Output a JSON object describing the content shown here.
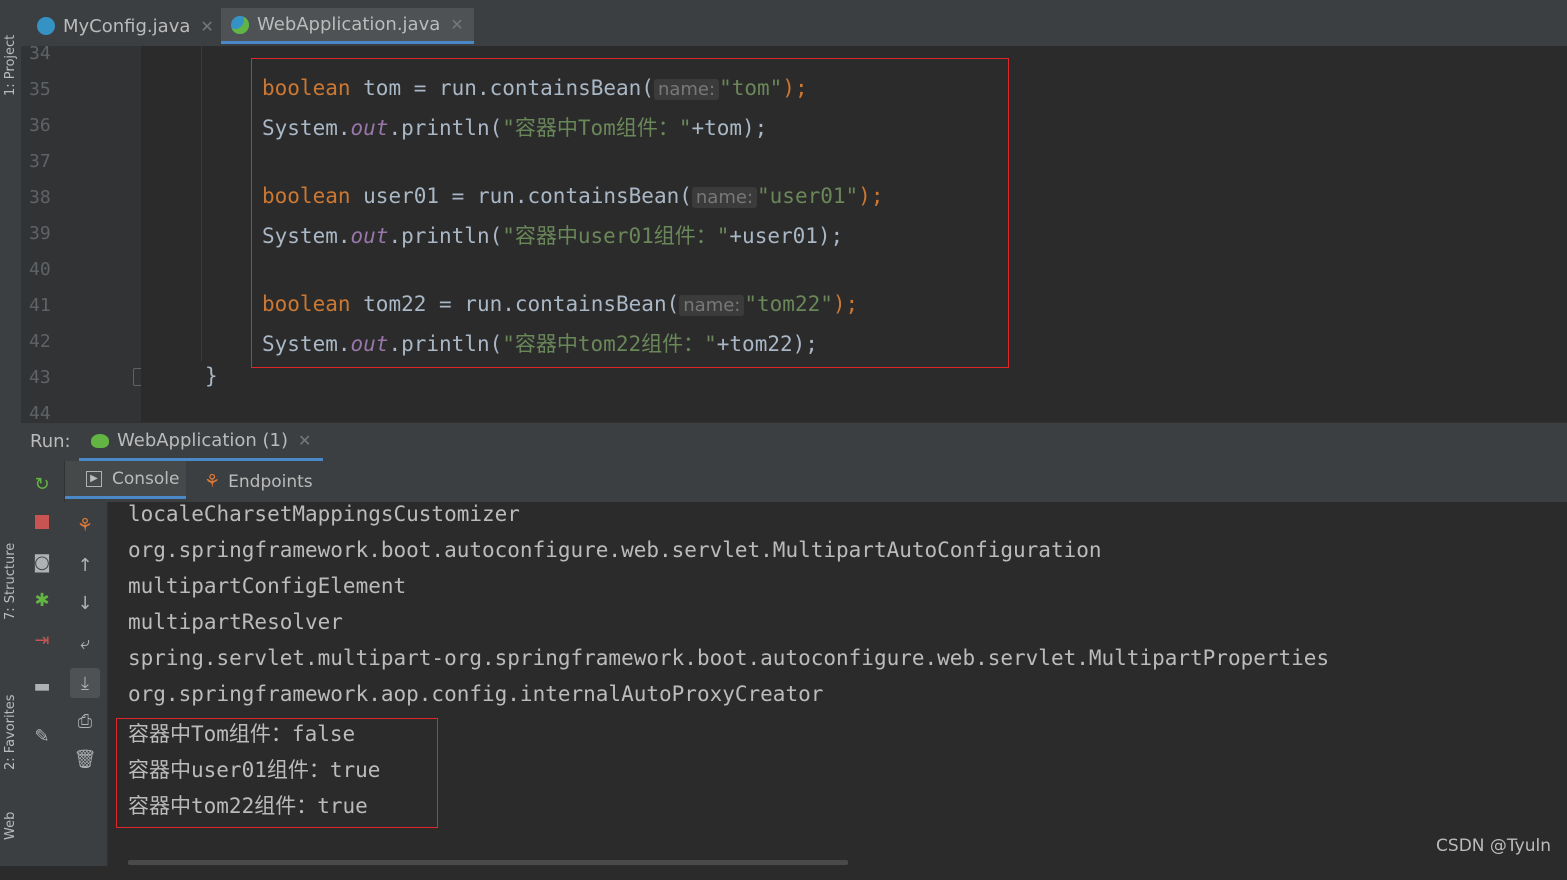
{
  "sidebar": {
    "project": "1: Project",
    "structure": "7: Structure",
    "favorites": "2: Favorites",
    "web": "Web"
  },
  "tabs": [
    {
      "label": "MyConfig.java",
      "icon": "java-class-icon",
      "active": false
    },
    {
      "label": "WebApplication.java",
      "icon": "spring-boot-class-icon",
      "active": true
    }
  ],
  "editor": {
    "line_numbers": [
      "34",
      "35",
      "36",
      "37",
      "38",
      "39",
      "40",
      "41",
      "42",
      "43",
      "44"
    ],
    "lines": [
      {
        "kw": "boolean",
        "text": " tom = run.containsBean(",
        "hint": "name:",
        "str": "\"tom\"",
        "tail": ");"
      },
      {
        "pre": "System.",
        "fld": "out",
        "mid": ".println(",
        "str": "\"容器中Tom组件：\"",
        "tail": "+tom);"
      },
      {
        "kw": "boolean",
        "text": " user01 = run.containsBean(",
        "hint": "name:",
        "str": "\"user01\"",
        "tail": ");"
      },
      {
        "pre": "System.",
        "fld": "out",
        "mid": ".println(",
        "str": "\"容器中user01组件：\"",
        "tail": "+user01);"
      },
      {
        "kw": "boolean",
        "text": " tom22 = run.containsBean(",
        "hint": "name:",
        "str": "\"tom22\"",
        "tail": ");"
      },
      {
        "pre": "System.",
        "fld": "out",
        "mid": ".println(",
        "str": "\"容器中tom22组件：\"",
        "tail": "+tom22);"
      }
    ],
    "closing_brace": "}"
  },
  "run": {
    "label": "Run:",
    "config_tab": "WebApplication (1)",
    "console_tab": "Console",
    "endpoints_tab": "Endpoints"
  },
  "console": {
    "lines": [
      "localeCharsetMappingsCustomizer",
      "org.springframework.boot.autoconfigure.web.servlet.MultipartAutoConfiguration",
      "multipartConfigElement",
      "multipartResolver",
      "spring.servlet.multipart-org.springframework.boot.autoconfigure.web.servlet.MultipartProperties",
      "org.springframework.aop.config.internalAutoProxyCreator",
      "容器中Tom组件：false",
      "容器中user01组件：true",
      "容器中tom22组件：true"
    ]
  },
  "watermark": "CSDN @Tyuln",
  "colors": {
    "keyword": "#cc7832",
    "string": "#6a8759",
    "field": "#9876aa",
    "highlight_box": "#e0262a",
    "active_tab_underline": "#4a88c7"
  }
}
